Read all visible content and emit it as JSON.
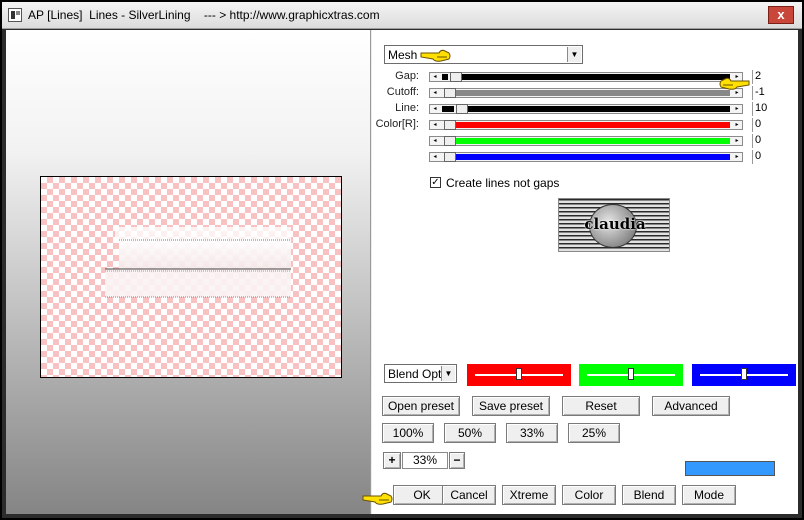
{
  "window": {
    "title": "AP [Lines]  Lines - SilverLining    --- > http://www.graphicxtras.com",
    "close_label": "x"
  },
  "controls": {
    "mode_select": "Mesh",
    "sliders": [
      {
        "label": "Gap:",
        "value": "2",
        "level": 0.02,
        "fill": "#000000"
      },
      {
        "label": "Cutoff:",
        "value": "-1",
        "level": 0.0,
        "fill": "#888888"
      },
      {
        "label": "Line:",
        "value": "10",
        "level": 0.04,
        "fill": "#000000"
      },
      {
        "label": "Color[R]:",
        "value": "0",
        "level": 0.0,
        "fill": "#ff0000"
      },
      {
        "label": "",
        "value": "0",
        "level": 0.0,
        "fill": "#00ff00"
      },
      {
        "label": "",
        "value": "0",
        "level": 0.0,
        "fill": "#0000ff"
      }
    ],
    "checkbox_label": "Create lines not gaps",
    "checkbox_checked": true,
    "logo_text": "claudia"
  },
  "blend": {
    "select_value": "Blend Optio",
    "color_sliders": [
      {
        "color": "#ff0000",
        "level": 0.5
      },
      {
        "color": "#00ff00",
        "level": 0.5
      },
      {
        "color": "#0000ff",
        "level": 0.5
      }
    ]
  },
  "buttons": {
    "open_preset": "Open preset",
    "save_preset": "Save preset",
    "reset": "Reset",
    "advanced": "Advanced",
    "zoom_100": "100%",
    "zoom_50": "50%",
    "zoom_33": "33%",
    "zoom_25": "25%",
    "zoom_plus": "+",
    "zoom_value": "33%",
    "zoom_minus": "−",
    "ok": "OK",
    "cancel": "Cancel",
    "xtreme": "Xtreme",
    "color": "Color",
    "blend": "Blend",
    "mode": "Mode"
  },
  "colors": {
    "swatch": "#3399ff",
    "pointer": "#ffe000"
  }
}
